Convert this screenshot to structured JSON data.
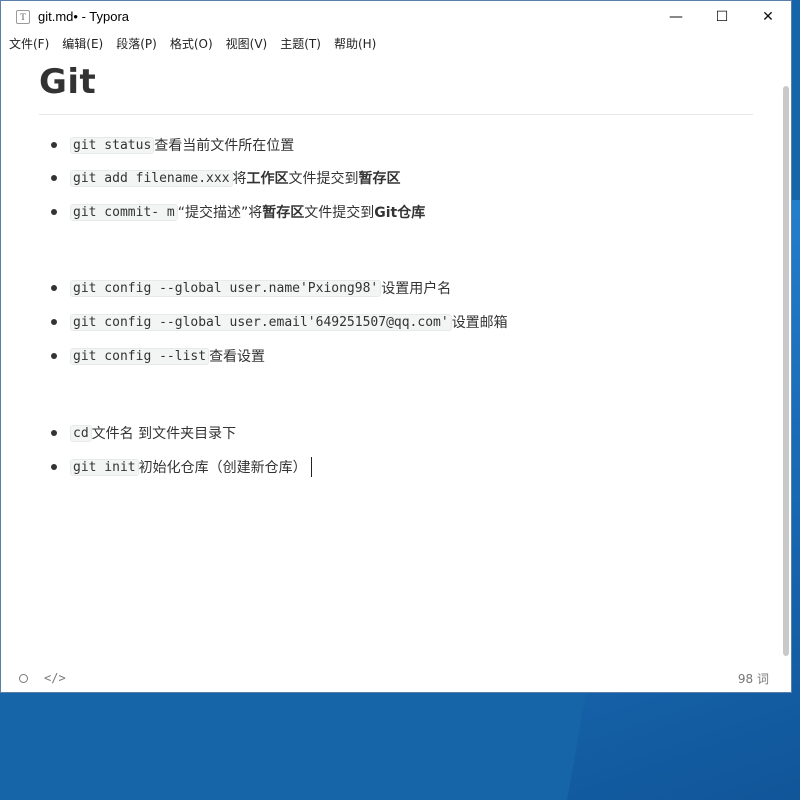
{
  "window": {
    "title": "git.md• - Typora",
    "app_icon_glyph": "T",
    "controls": {
      "minimize": "—",
      "maximize": "☐",
      "close": "✕"
    }
  },
  "menu": [
    "文件(F)",
    "编辑(E)",
    "段落(P)",
    "格式(O)",
    "视图(V)",
    "主题(T)",
    "帮助(H)"
  ],
  "document": {
    "title": "Git",
    "list_items": [
      {
        "code": "git status",
        "text": "查看当前文件所在位置"
      },
      {
        "code": "git add filename.xxx",
        "parts": [
          "将",
          "工作区",
          "文件提交到",
          "暂存区"
        ]
      },
      {
        "code": "git commit- m",
        "parts": [
          "“提交描述”将",
          "暂存区",
          "文件提交到",
          "Git仓库"
        ]
      },
      {
        "code": "git config --global user.name'Pxiong98'",
        "text": "设置用户名"
      },
      {
        "code": "git config --global user.email'649251507@qq.com'",
        "text": "设置邮箱"
      },
      {
        "code": "git config --list",
        "text": "查看设置"
      },
      {
        "code": "cd",
        "text": "文件名 到文件夹目录下"
      },
      {
        "code": "git init",
        "text": "初始化仓库（创建新仓库）"
      }
    ]
  },
  "statusbar": {
    "outline_icon": "circle-icon",
    "source_mode_icon": "</>",
    "word_count": "98 词"
  }
}
